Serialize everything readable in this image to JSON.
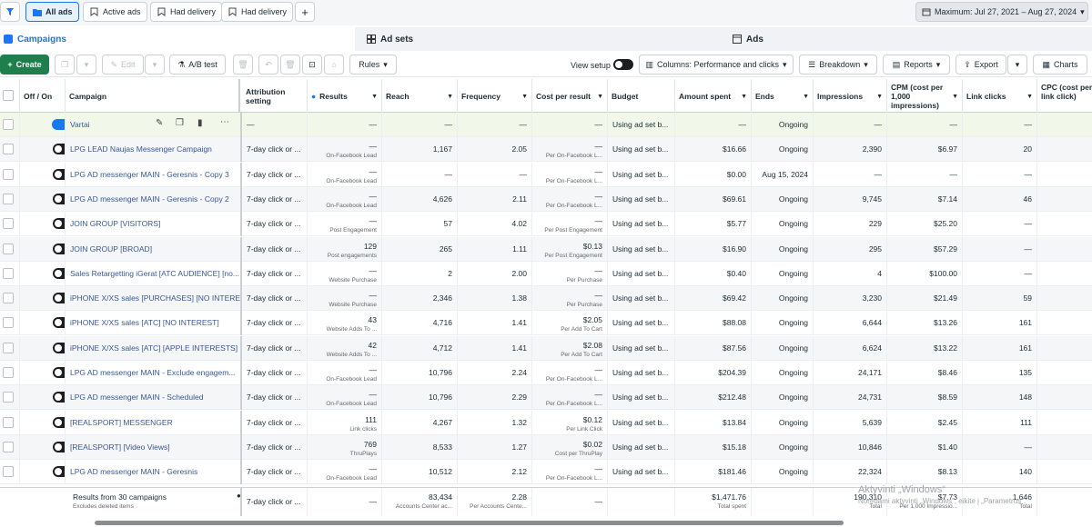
{
  "filters": {
    "all_ads": "All ads",
    "active_ads": "Active ads",
    "had_delivery_1": "Had delivery",
    "had_delivery_2": "Had delivery",
    "add": "+",
    "date_range": "Maximum: Jul 27, 2021 – Aug 27, 2024"
  },
  "tabs": {
    "campaigns": "Campaigns",
    "ad_sets": "Ad sets",
    "ads": "Ads"
  },
  "toolbar": {
    "create": "Create",
    "edit": "Edit",
    "ab_test": "A/B test",
    "rules": "Rules",
    "view_setup": "View setup",
    "columns": "Columns: Performance and clicks",
    "breakdown": "Breakdown",
    "reports": "Reports",
    "export": "Export",
    "charts": "Charts"
  },
  "columns": {
    "off_on": "Off / On",
    "campaign": "Campaign",
    "attribution": "Attribution setting",
    "results": "Results",
    "reach": "Reach",
    "frequency": "Frequency",
    "cost_per_result": "Cost per result",
    "budget": "Budget",
    "amount_spent": "Amount spent",
    "ends": "Ends",
    "impressions": "Impressions",
    "cpm": "CPM (cost per 1,000 impressions)",
    "link_clicks": "Link clicks",
    "cpc": "CPC (cost per link click)"
  },
  "rows": [
    {
      "name": "Vartai",
      "attr": "—",
      "res": "—",
      "res_sub": "",
      "reach": "—",
      "freq": "—",
      "cpr": "—",
      "cpr_sub": "",
      "budget": "Using ad set b...",
      "spent": "—",
      "ends": "Ongoing",
      "impr": "—",
      "cpm": "—",
      "clicks": "—",
      "on": true
    },
    {
      "name": "LPG LEAD Naujas Messenger Campaign",
      "attr": "7-day click or ...",
      "res": "—",
      "res_sub": "On-Facebook Lead",
      "reach": "1,167",
      "freq": "2.05",
      "cpr": "—",
      "cpr_sub": "Per On-Facebook L...",
      "budget": "Using ad set b...",
      "spent": "$16.66",
      "ends": "Ongoing",
      "impr": "2,390",
      "cpm": "$6.97",
      "clicks": "20",
      "on": false
    },
    {
      "name": "LPG AD messenger MAIN - Geresnis - Copy 3",
      "attr": "7-day click or ...",
      "res": "—",
      "res_sub": "On-Facebook Lead",
      "reach": "—",
      "freq": "—",
      "cpr": "—",
      "cpr_sub": "Per On-Facebook L...",
      "budget": "Using ad set b...",
      "spent": "$0.00",
      "ends": "Aug 15, 2024",
      "impr": "—",
      "cpm": "—",
      "clicks": "—",
      "on": false
    },
    {
      "name": "LPG AD messenger MAIN - Geresnis - Copy 2",
      "attr": "7-day click or ...",
      "res": "—",
      "res_sub": "On-Facebook Lead",
      "reach": "4,626",
      "freq": "2.11",
      "cpr": "—",
      "cpr_sub": "Per On-Facebook L...",
      "budget": "Using ad set b...",
      "spent": "$69.61",
      "ends": "Ongoing",
      "impr": "9,745",
      "cpm": "$7.14",
      "clicks": "46",
      "on": false
    },
    {
      "name": "JOIN GROUP [VISITORS]",
      "attr": "7-day click or ...",
      "res": "—",
      "res_sub": "Post Engagement",
      "reach": "57",
      "freq": "4.02",
      "cpr": "—",
      "cpr_sub": "Per Post Engagement",
      "budget": "Using ad set b...",
      "spent": "$5.77",
      "ends": "Ongoing",
      "impr": "229",
      "cpm": "$25.20",
      "clicks": "—",
      "on": false
    },
    {
      "name": "JOIN GROUP [BROAD]",
      "attr": "7-day click or ...",
      "res": "129",
      "res_sub": "Post engagements",
      "reach": "265",
      "freq": "1.11",
      "cpr": "$0.13",
      "cpr_sub": "Per Post Engagement",
      "budget": "Using ad set b...",
      "spent": "$16.90",
      "ends": "Ongoing",
      "impr": "295",
      "cpm": "$57.29",
      "clicks": "—",
      "on": false
    },
    {
      "name": "Sales Retargetting iGerat [ATC AUDIENCE] [no...",
      "attr": "7-day click or ...",
      "res": "—",
      "res_sub": "Website Purchase",
      "reach": "2",
      "freq": "2.00",
      "cpr": "—",
      "cpr_sub": "Per Purchase",
      "budget": "Using ad set b...",
      "spent": "$0.40",
      "ends": "Ongoing",
      "impr": "4",
      "cpm": "$100.00",
      "clicks": "—",
      "on": false
    },
    {
      "name": "iPHONE X/XS sales [PURCHASES] [NO INTERE...",
      "attr": "7-day click or ...",
      "res": "—",
      "res_sub": "Website Purchase",
      "reach": "2,346",
      "freq": "1.38",
      "cpr": "—",
      "cpr_sub": "Per Purchase",
      "budget": "Using ad set b...",
      "spent": "$69.42",
      "ends": "Ongoing",
      "impr": "3,230",
      "cpm": "$21.49",
      "clicks": "59",
      "on": false
    },
    {
      "name": "iPHONE X/XS sales [ATC] [NO INTEREST]",
      "attr": "7-day click or ...",
      "res": "43",
      "res_sub": "Website Adds To ...",
      "reach": "4,716",
      "freq": "1.41",
      "cpr": "$2.05",
      "cpr_sub": "Per Add To Cart",
      "budget": "Using ad set b...",
      "spent": "$88.08",
      "ends": "Ongoing",
      "impr": "6,644",
      "cpm": "$13.26",
      "clicks": "161",
      "on": false
    },
    {
      "name": "iPHONE X/XS sales [ATC] [APPLE INTERESTS]",
      "attr": "7-day click or ...",
      "res": "42",
      "res_sub": "Website Adds To ...",
      "reach": "4,712",
      "freq": "1.41",
      "cpr": "$2.08",
      "cpr_sub": "Per Add To Cart",
      "budget": "Using ad set b...",
      "spent": "$87.56",
      "ends": "Ongoing",
      "impr": "6,624",
      "cpm": "$13.22",
      "clicks": "161",
      "on": false
    },
    {
      "name": "LPG AD messenger MAIN - Exclude engagem...",
      "attr": "7-day click or ...",
      "res": "—",
      "res_sub": "On-Facebook Lead",
      "reach": "10,796",
      "freq": "2.24",
      "cpr": "—",
      "cpr_sub": "Per On-Facebook L...",
      "budget": "Using ad set b...",
      "spent": "$204.39",
      "ends": "Ongoing",
      "impr": "24,171",
      "cpm": "$8.46",
      "clicks": "135",
      "on": false
    },
    {
      "name": "LPG AD messenger MAIN - Scheduled",
      "attr": "7-day click or ...",
      "res": "—",
      "res_sub": "On-Facebook Lead",
      "reach": "10,796",
      "freq": "2.29",
      "cpr": "—",
      "cpr_sub": "Per On-Facebook L...",
      "budget": "Using ad set b...",
      "spent": "$212.48",
      "ends": "Ongoing",
      "impr": "24,731",
      "cpm": "$8.59",
      "clicks": "148",
      "on": false
    },
    {
      "name": "[REALSPORT] MESSENGER",
      "attr": "7-day click or ...",
      "res": "111",
      "res_sub": "Link clicks",
      "reach": "4,267",
      "freq": "1.32",
      "cpr": "$0.12",
      "cpr_sub": "Per Link Click",
      "budget": "Using ad set b...",
      "spent": "$13.84",
      "ends": "Ongoing",
      "impr": "5,639",
      "cpm": "$2.45",
      "clicks": "111",
      "on": false
    },
    {
      "name": "[REALSPORT] [Video Views]",
      "attr": "7-day click or ...",
      "res": "769",
      "res_sub": "ThruPlays",
      "reach": "8,533",
      "freq": "1.27",
      "cpr": "$0.02",
      "cpr_sub": "Cost per ThruPlay",
      "budget": "Using ad set b...",
      "spent": "$15.18",
      "ends": "Ongoing",
      "impr": "10,846",
      "cpm": "$1.40",
      "clicks": "—",
      "on": false
    },
    {
      "name": "LPG AD messenger MAIN - Geresnis",
      "attr": "7-day click or ...",
      "res": "—",
      "res_sub": "On-Facebook Lead",
      "reach": "10,512",
      "freq": "2.12",
      "cpr": "—",
      "cpr_sub": "Per On-Facebook L...",
      "budget": "Using ad set b...",
      "spent": "$181.46",
      "ends": "Ongoing",
      "impr": "22,324",
      "cpm": "$8.13",
      "clicks": "140",
      "on": false
    }
  ],
  "totals": {
    "label": "Results from 30 campaigns",
    "sub": "Excludes deleted items",
    "attr": "7-day click or ...",
    "res": "—",
    "reach": "83,434",
    "reach_sub": "Accounts Center ac...",
    "freq": "2.28",
    "freq_sub": "Per Accounts Cente...",
    "cpr": "—",
    "spent": "$1,471.76",
    "spent_sub": "Total spent",
    "impr": "190,310",
    "impr_sub": "Total",
    "cpm": "$7.73",
    "cpm_sub": "Per 1,000 Impressio...",
    "clicks": "1,646",
    "clicks_sub": "Total"
  },
  "watermark": {
    "line1": "Aktyvinti „Windows“",
    "line2": "Norėdami aktyvinti „Windows“, eikite į „Parametrus“."
  }
}
